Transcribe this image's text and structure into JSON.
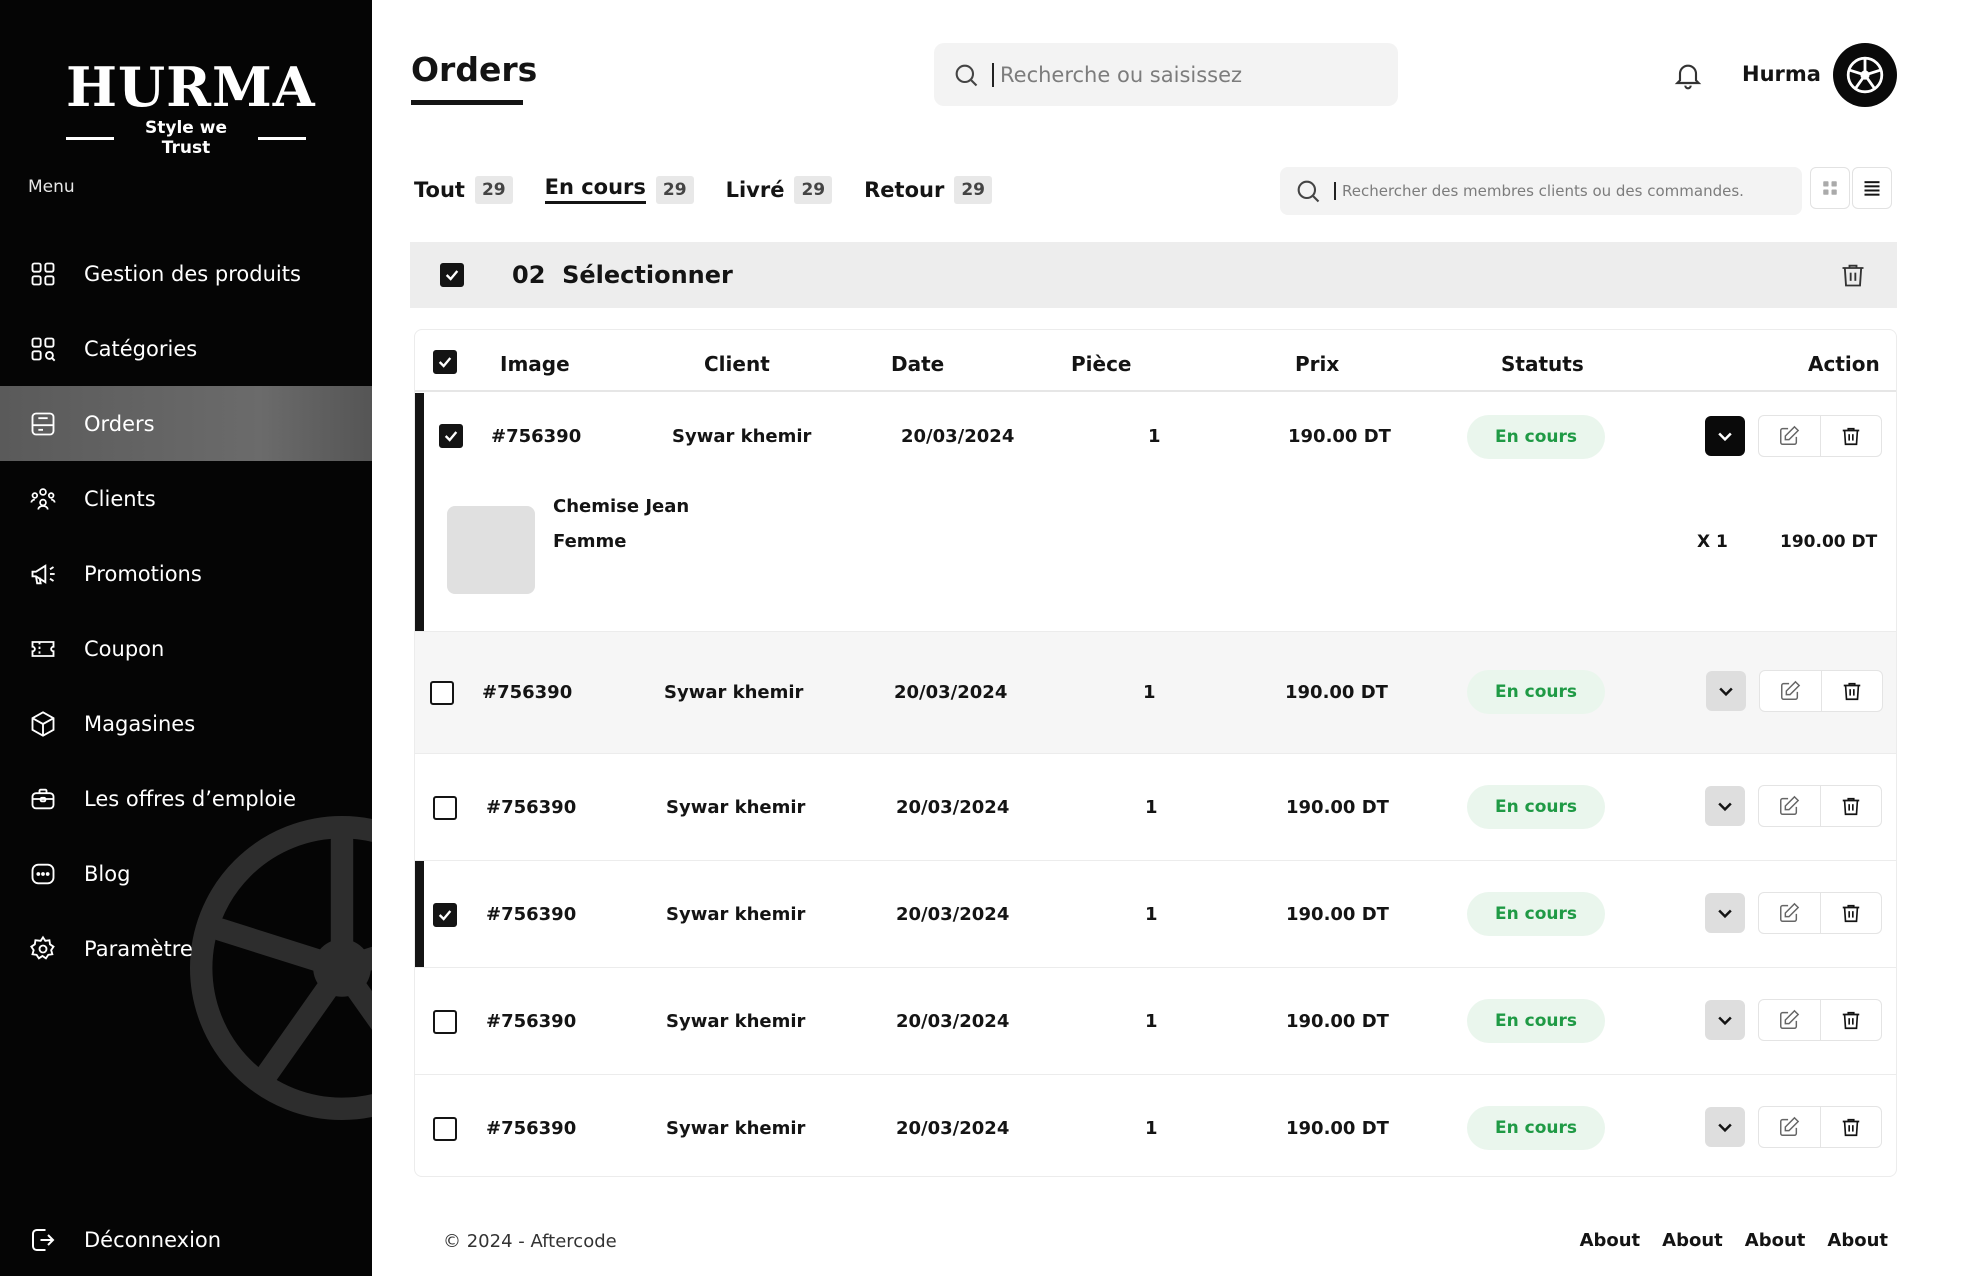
{
  "brand": {
    "name": "HURMA",
    "tagline": "Style we Trust"
  },
  "sidebar": {
    "menu_label": "Menu",
    "items": [
      {
        "label": "Gestion des produits",
        "icon": "grid-icon"
      },
      {
        "label": "Catégories",
        "icon": "category-icon"
      },
      {
        "label": "Orders",
        "icon": "orders-icon",
        "active": true
      },
      {
        "label": "Clients",
        "icon": "users-icon"
      },
      {
        "label": "Promotions",
        "icon": "megaphone-icon"
      },
      {
        "label": "Coupon",
        "icon": "ticket-icon"
      },
      {
        "label": "Magasines",
        "icon": "box-icon"
      },
      {
        "label": "Les offres d’emploie",
        "icon": "briefcase-icon"
      },
      {
        "label": "Blog",
        "icon": "chat-icon"
      },
      {
        "label": "Paramètre",
        "icon": "gear-icon"
      }
    ],
    "logout_label": "Déconnexion"
  },
  "header": {
    "title": "Orders",
    "search_placeholder": "Recherche ou saisissez",
    "user_name": "Hurma"
  },
  "tabs": [
    {
      "label": "Tout",
      "count": "29"
    },
    {
      "label": "En cours",
      "count": "29",
      "active": true
    },
    {
      "label": "Livré",
      "count": "29"
    },
    {
      "label": "Retour",
      "count": "29"
    }
  ],
  "filter_search_placeholder": "Rechercher des membres clients ou des commandes.",
  "selection": {
    "label": "02  Sélectionner"
  },
  "table": {
    "columns": [
      "Image",
      "Client",
      "Date",
      "Pièce",
      "Prix",
      "Statuts",
      "Action"
    ],
    "rows": [
      {
        "id": "#756390",
        "client": "Sywar khemir",
        "date": "20/03/2024",
        "qty": "1",
        "price": "190.00 DT",
        "status": "En cours",
        "checked": true,
        "expanded": true
      },
      {
        "id": "#756390",
        "client": "Sywar khemir",
        "date": "20/03/2024",
        "qty": "1",
        "price": "190.00 DT",
        "status": "En cours",
        "checked": false
      },
      {
        "id": "#756390",
        "client": "Sywar khemir",
        "date": "20/03/2024",
        "qty": "1",
        "price": "190.00 DT",
        "status": "En cours",
        "checked": false
      },
      {
        "id": "#756390",
        "client": "Sywar khemir",
        "date": "20/03/2024",
        "qty": "1",
        "price": "190.00 DT",
        "status": "En cours",
        "checked": true
      },
      {
        "id": "#756390",
        "client": "Sywar khemir",
        "date": "20/03/2024",
        "qty": "1",
        "price": "190.00 DT",
        "status": "En cours",
        "checked": false
      },
      {
        "id": "#756390",
        "client": "Sywar khemir",
        "date": "20/03/2024",
        "qty": "1",
        "price": "190.00 DT",
        "status": "En cours",
        "checked": false
      }
    ],
    "detail": {
      "name_line1": "Chemise Jean",
      "name_line2": "Femme",
      "qty": "X 1",
      "price": "190.00 DT"
    }
  },
  "footer": {
    "copyright": "© 2024 - Aftercode",
    "links": [
      "About",
      "About",
      "About",
      "About"
    ]
  },
  "colors": {
    "accent": "#141414",
    "status_bg": "#eaf6ed",
    "status_text": "#1f9a45",
    "sidebar_bg": "#050505"
  }
}
